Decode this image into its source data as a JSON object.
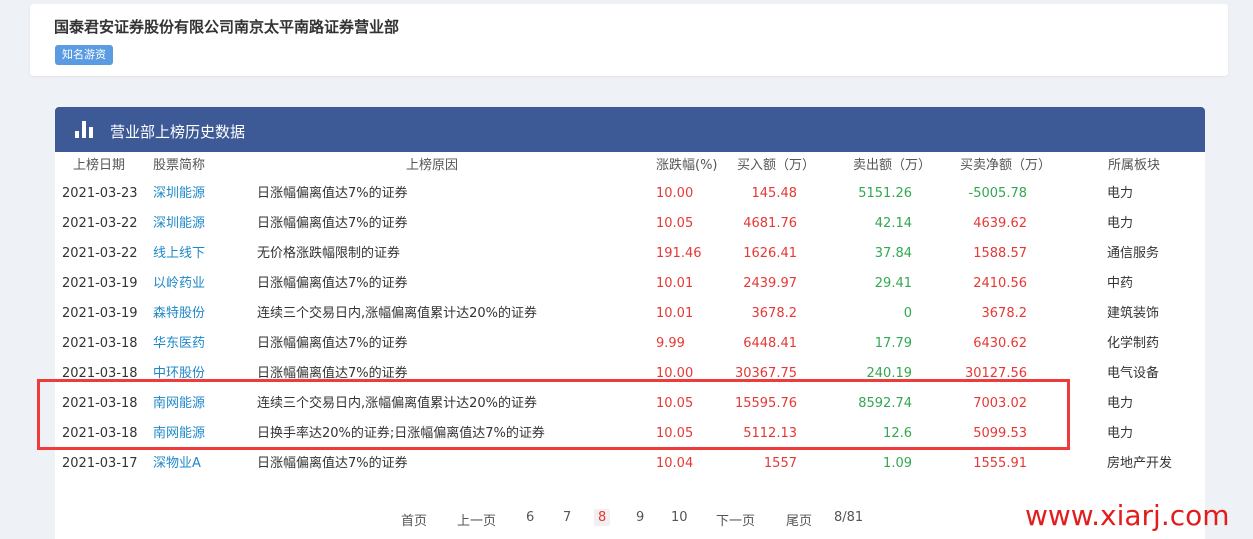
{
  "header": {
    "firm_name": "国泰君安证券股份有限公司南京太平南路证券营业部",
    "tag": "知名游资"
  },
  "panel": {
    "title": "营业部上榜历史数据"
  },
  "columns": {
    "date": "上榜日期",
    "stock": "股票简称",
    "reason": "上榜原因",
    "change": "涨跌幅(%)",
    "buy": "买入额（万）",
    "sell": "卖出额（万）",
    "net": "买卖净额（万）",
    "sector": "所属板块"
  },
  "rows": [
    {
      "date": "2021-03-23",
      "stock": "深圳能源",
      "reason": "日涨幅偏离值达7%的证券",
      "change": "10.00",
      "buy": "145.48",
      "sell": "5151.26",
      "net": "-5005.78",
      "net_color": "green",
      "sector": "电力"
    },
    {
      "date": "2021-03-22",
      "stock": "深圳能源",
      "reason": "日涨幅偏离值达7%的证券",
      "change": "10.05",
      "buy": "4681.76",
      "sell": "42.14",
      "net": "4639.62",
      "net_color": "red",
      "sector": "电力"
    },
    {
      "date": "2021-03-22",
      "stock": "线上线下",
      "reason": "无价格涨跌幅限制的证券",
      "change": "191.46",
      "buy": "1626.41",
      "sell": "37.84",
      "net": "1588.57",
      "net_color": "red",
      "sector": "通信服务"
    },
    {
      "date": "2021-03-19",
      "stock": "以岭药业",
      "reason": "日涨幅偏离值达7%的证券",
      "change": "10.01",
      "buy": "2439.97",
      "sell": "29.41",
      "net": "2410.56",
      "net_color": "red",
      "sector": "中药"
    },
    {
      "date": "2021-03-19",
      "stock": "森特股份",
      "reason": "连续三个交易日内,涨幅偏离值累计达20%的证券",
      "change": "10.01",
      "buy": "3678.2",
      "sell": "0",
      "net": "3678.2",
      "net_color": "red",
      "sector": "建筑装饰"
    },
    {
      "date": "2021-03-18",
      "stock": "华东医药",
      "reason": "日涨幅偏离值达7%的证券",
      "change": "9.99",
      "buy": "6448.41",
      "sell": "17.79",
      "net": "6430.62",
      "net_color": "red",
      "sector": "化学制药"
    },
    {
      "date": "2021-03-18",
      "stock": "中环股份",
      "reason": "日涨幅偏离值达7%的证券",
      "change": "10.00",
      "buy": "30367.75",
      "sell": "240.19",
      "net": "30127.56",
      "net_color": "red",
      "sector": "电气设备"
    },
    {
      "date": "2021-03-18",
      "stock": "南网能源",
      "reason": "连续三个交易日内,涨幅偏离值累计达20%的证券",
      "change": "10.05",
      "buy": "15595.76",
      "sell": "8592.74",
      "net": "7003.02",
      "net_color": "red",
      "sector": "电力"
    },
    {
      "date": "2021-03-18",
      "stock": "南网能源",
      "reason": "日换手率达20%的证券;日涨幅偏离值达7%的证券",
      "change": "10.05",
      "buy": "5112.13",
      "sell": "12.6",
      "net": "5099.53",
      "net_color": "red",
      "sector": "电力"
    },
    {
      "date": "2021-03-17",
      "stock": "深物业A",
      "reason": "日涨幅偏离值达7%的证券",
      "change": "10.04",
      "buy": "1557",
      "sell": "1.09",
      "net": "1555.91",
      "net_color": "red",
      "sector": "房地产开发"
    }
  ],
  "pagination": {
    "first": "首页",
    "prev": "上一页",
    "pages": [
      "6",
      "7",
      "8",
      "9",
      "10"
    ],
    "current": "8",
    "next": "下一页",
    "last": "尾页",
    "info": "8/81"
  },
  "watermark": "www.xiarj.com",
  "colors": {
    "header_bg": "#3d5a96",
    "up": "#e53935",
    "down": "#32a852",
    "link": "#1e88c8",
    "highlight": "#ef3b3b"
  }
}
